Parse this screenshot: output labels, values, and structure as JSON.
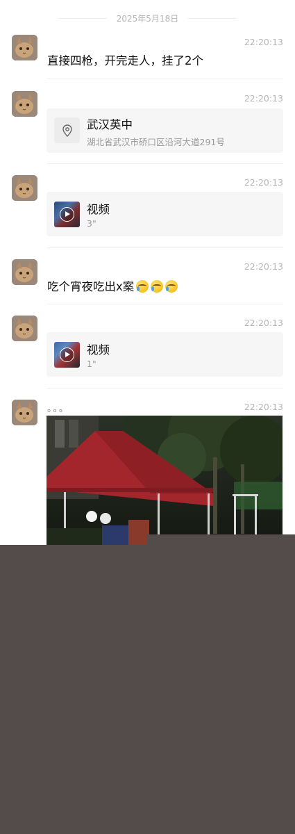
{
  "date_separator": "2025年5月18日",
  "messages": [
    {
      "time": "22:20:13",
      "text": "直接四枪，开完走人，挂了2个"
    },
    {
      "time": "22:20:13",
      "location": {
        "title": "武汉英中",
        "address": "湖北省武汉市硚口区沿河大道291号"
      }
    },
    {
      "time": "22:20:13",
      "video": {
        "label": "视频",
        "duration": "3\""
      }
    },
    {
      "time": "22:20:13",
      "text": "吃个宵夜吃出x案"
    },
    {
      "time": "22:20:13",
      "video": {
        "label": "视频",
        "duration": "1\""
      }
    },
    {
      "time": "22:20:13",
      "text": "。。。"
    }
  ],
  "icons": {
    "avatar": "cat-avatar",
    "location": "location-pin-icon",
    "video": "video-play-icon",
    "emoji": "laugh-cry-emoji"
  },
  "colors": {
    "time": "#b5b5b5",
    "card_bg": "#f6f6f6",
    "bottom_fill": "#544b4b"
  }
}
